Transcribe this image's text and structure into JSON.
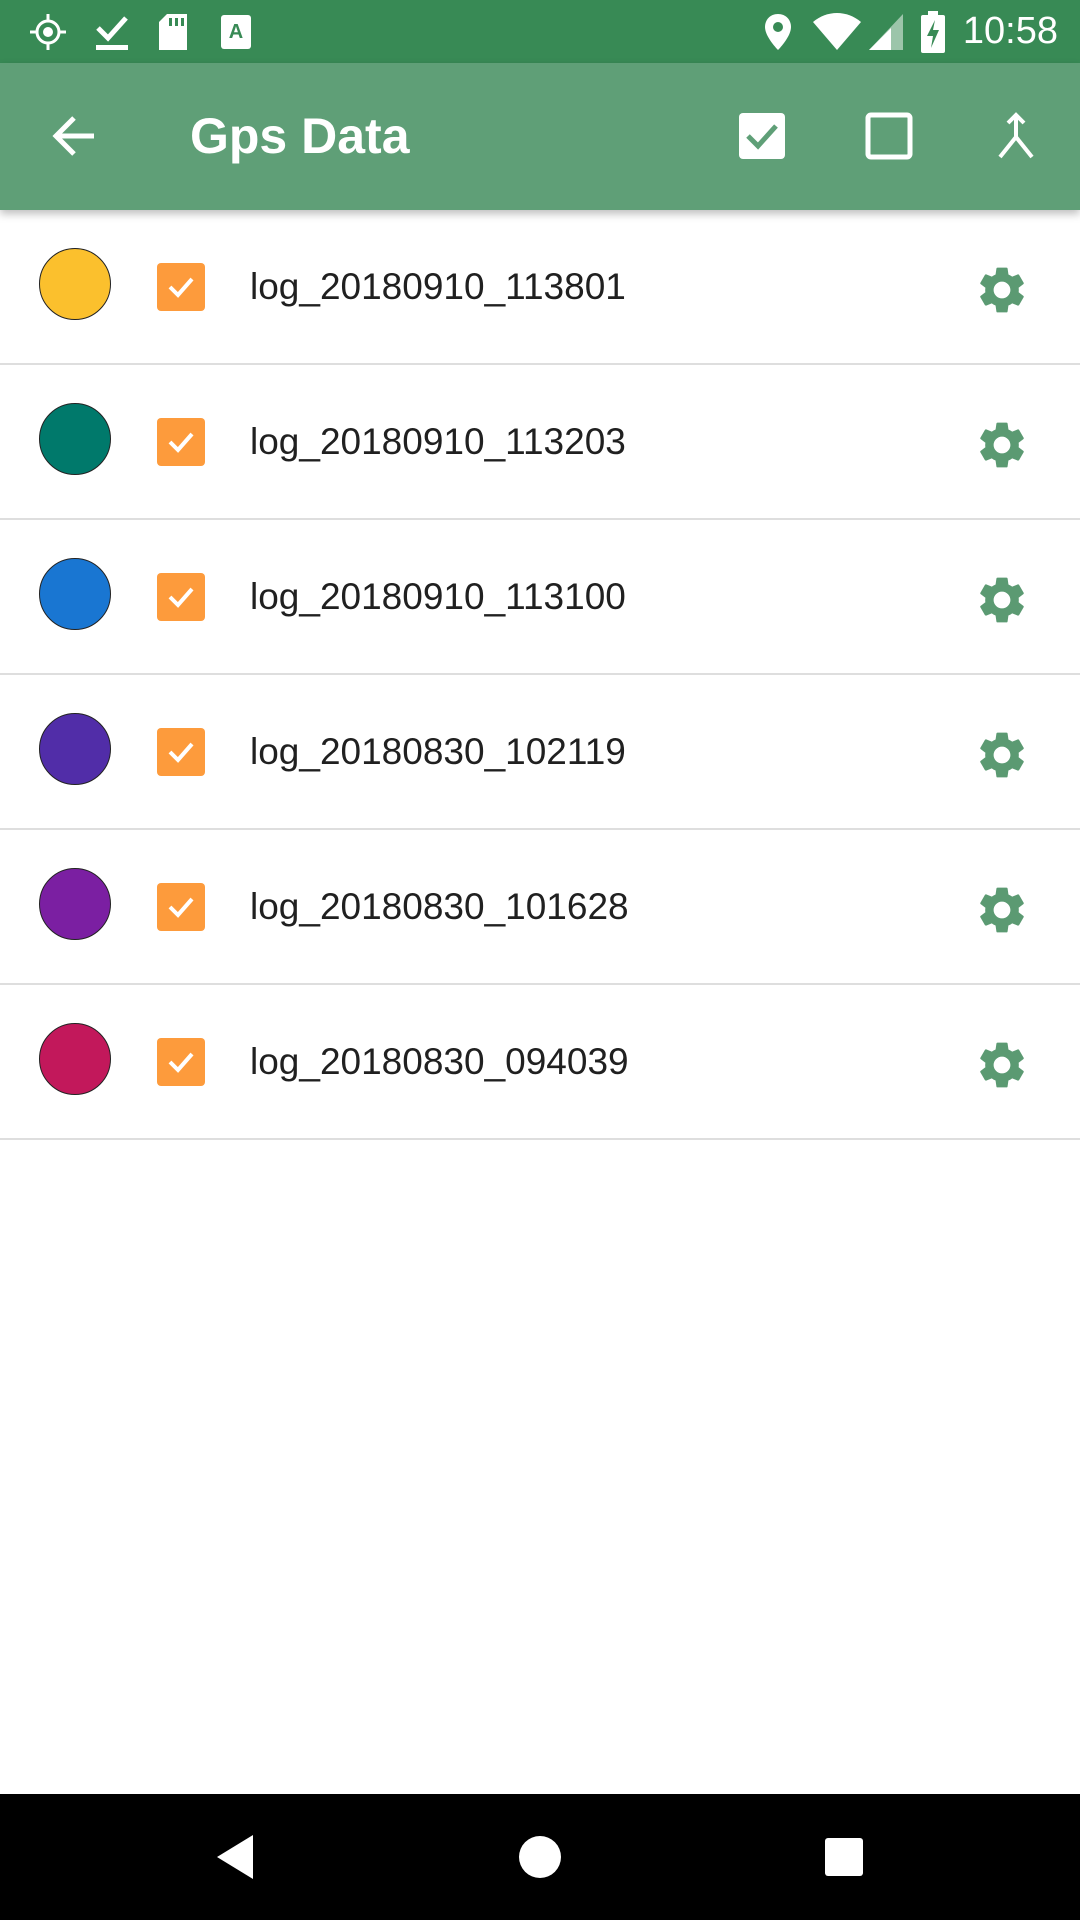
{
  "status_bar": {
    "time": "10:58",
    "left_icons": [
      "location-target-icon",
      "download-done-icon",
      "sd-card-icon",
      "text-font-icon"
    ],
    "right_icons": [
      "location-pin-icon",
      "wifi-icon",
      "signal-icon",
      "battery-charging-icon"
    ],
    "background": "#388a55"
  },
  "app_bar": {
    "title": "Gps Data",
    "background": "#5f9f77",
    "actions": [
      "select-all-icon",
      "deselect-all-icon",
      "merge-icon"
    ]
  },
  "colors": {
    "checkbox": "#fd9b3c",
    "gear": "#5b9a72"
  },
  "tracks": [
    {
      "label": "log_20180910_113801",
      "color": "#fbc02d",
      "checked": true
    },
    {
      "label": "log_20180910_113203",
      "color": "#00796b",
      "checked": true
    },
    {
      "label": "log_20180910_113100",
      "color": "#1976d2",
      "checked": true
    },
    {
      "label": "log_20180830_102119",
      "color": "#512da8",
      "checked": true
    },
    {
      "label": "log_20180830_101628",
      "color": "#7b1fa2",
      "checked": true
    },
    {
      "label": "log_20180830_094039",
      "color": "#c2185b",
      "checked": true
    }
  ],
  "nav_bar": {
    "buttons": [
      "back-icon",
      "home-icon",
      "recents-icon"
    ]
  }
}
